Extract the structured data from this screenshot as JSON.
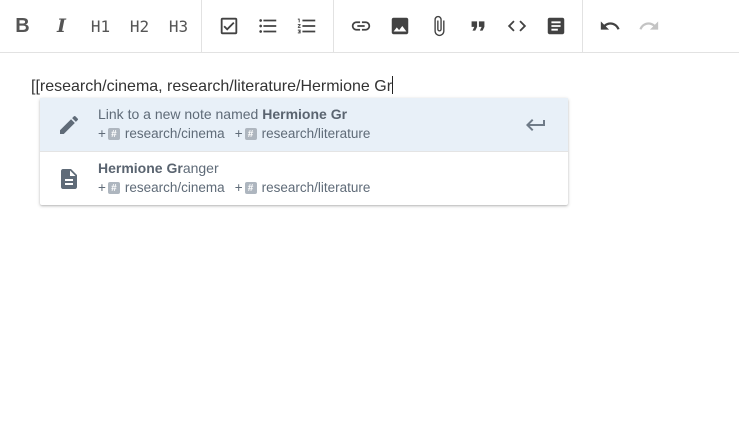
{
  "toolbar": {
    "bold_label": "B",
    "italic_label": "I",
    "h1_label": "H1",
    "h2_label": "H2",
    "h3_label": "H3"
  },
  "editor": {
    "text": "[[research/cinema, research/literature/Hermione Gr"
  },
  "suggestions": {
    "new_note": {
      "prefix": "Link to a new note named ",
      "name": "Hermione Gr",
      "tags": [
        {
          "plus": "+",
          "label": "research/cinema"
        },
        {
          "plus": "+",
          "label": "research/literature"
        }
      ]
    },
    "existing_note": {
      "match": "Hermione Gr",
      "rest": "anger",
      "tags": [
        {
          "plus": "+",
          "label": "research/cinema"
        },
        {
          "plus": "+",
          "label": "research/literature"
        }
      ]
    }
  },
  "icons": [
    "checkbox-icon",
    "bullet-list-icon",
    "numbered-list-icon",
    "link-icon",
    "image-icon",
    "attachment-icon",
    "quote-icon",
    "code-icon",
    "note-icon",
    "undo-icon",
    "redo-icon",
    "pencil-icon",
    "document-icon",
    "enter-icon"
  ]
}
